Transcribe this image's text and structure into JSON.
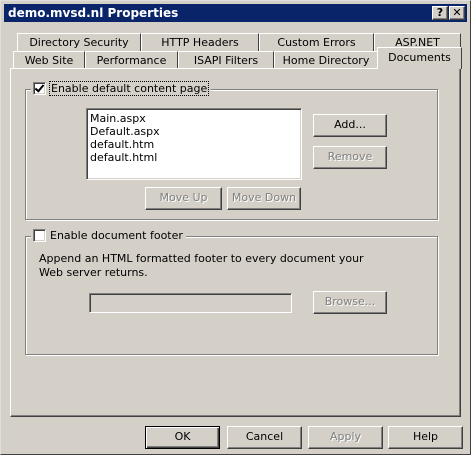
{
  "window": {
    "title": "demo.mvsd.nl  Properties",
    "help_button": "?",
    "close_button": "✕"
  },
  "tabs": {
    "back_row": [
      "Directory Security",
      "HTTP Headers",
      "Custom Errors",
      "ASP.NET"
    ],
    "front_row": [
      "Web Site",
      "Performance",
      "ISAPI Filters",
      "Home Directory",
      "Documents"
    ],
    "selected": "Documents"
  },
  "default_content": {
    "label": "Enable default content page",
    "checked": true,
    "documents": [
      "Main.aspx",
      "Default.aspx",
      "default.htm",
      "default.html"
    ],
    "add_label": "Add...",
    "remove_label": "Remove",
    "move_up_label": "Move Up",
    "move_down_label": "Move Down"
  },
  "footer": {
    "label": "Enable document footer",
    "checked": false,
    "description": "Append an HTML formatted footer to every document your Web server returns.",
    "path_value": "",
    "browse_label": "Browse..."
  },
  "buttons": {
    "ok": "OK",
    "cancel": "Cancel",
    "apply": "Apply",
    "help": "Help"
  }
}
